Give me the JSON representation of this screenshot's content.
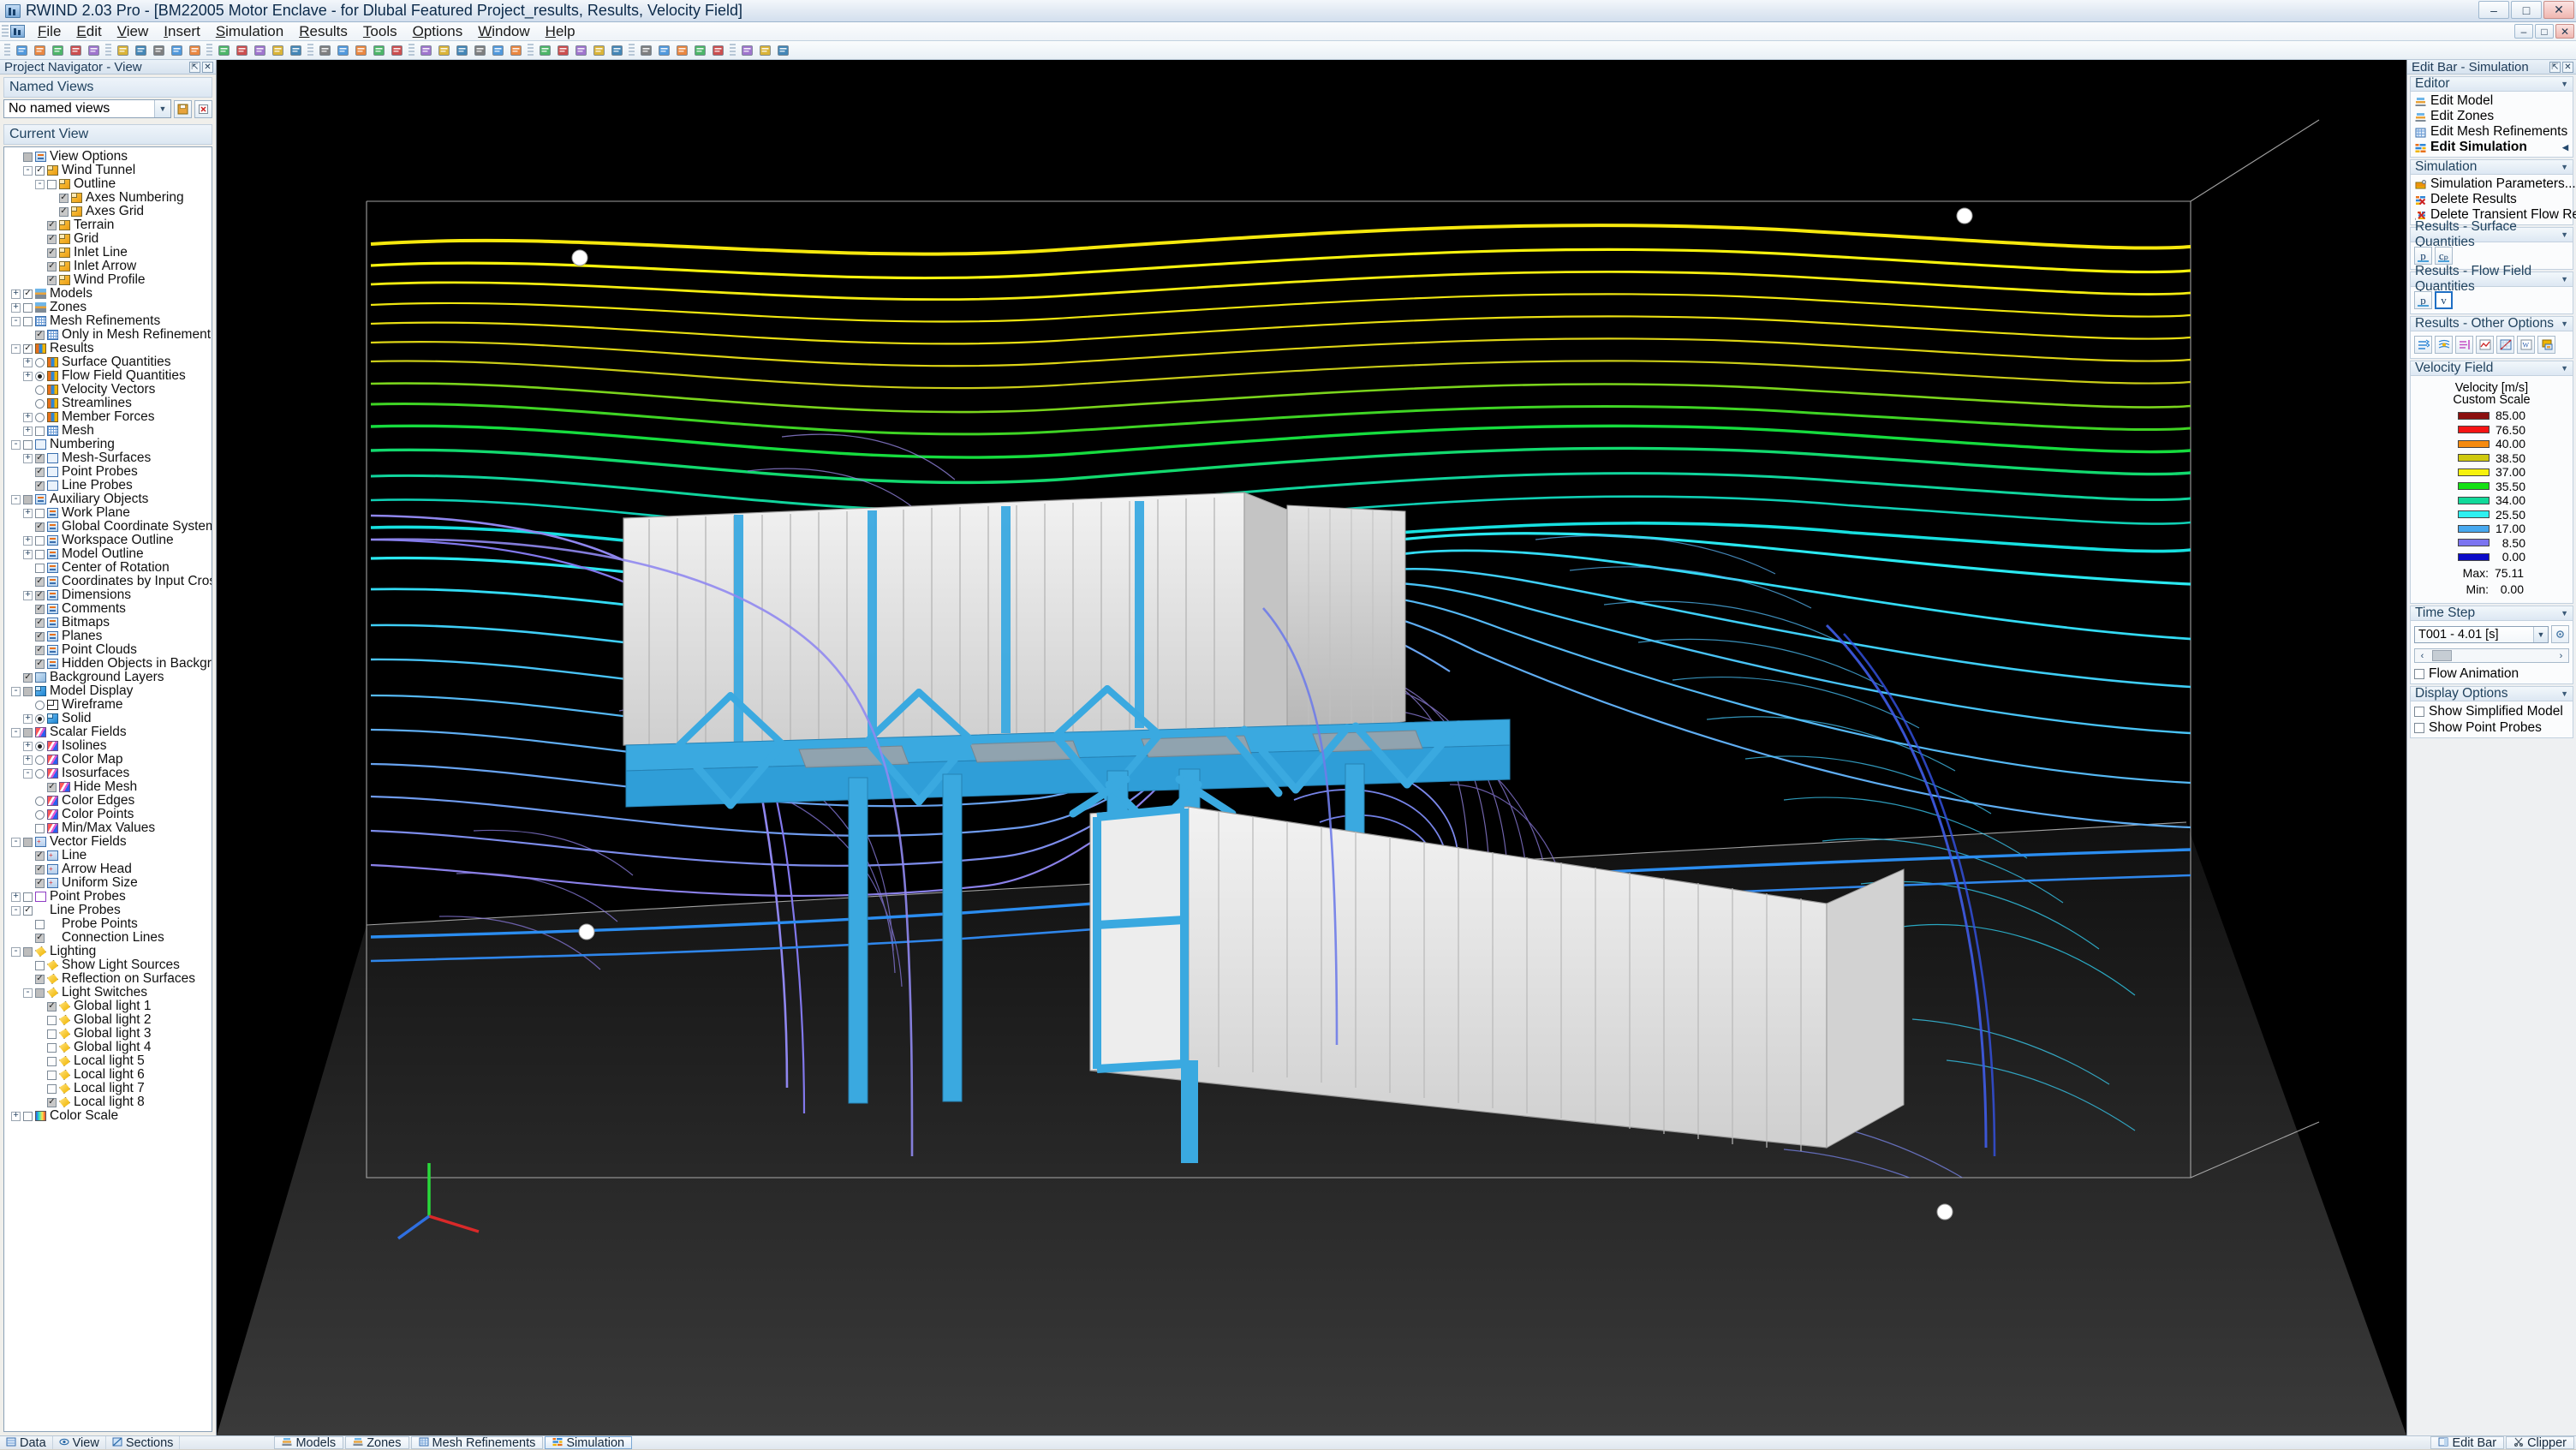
{
  "window": {
    "title": "RWIND 2.03 Pro - [BM22005 Motor Enclave - for Dlubal Featured Project_results, Results, Velocity Field]",
    "app_icon": "rwind-app-icon",
    "minimize": "–",
    "maximize": "□",
    "close": "✕"
  },
  "menu": [
    "File",
    "Edit",
    "View",
    "Insert",
    "Simulation",
    "Results",
    "Tools",
    "Options",
    "Window",
    "Help"
  ],
  "toolbar": {
    "icons": [
      "new-file-icon",
      "open-folder-icon",
      "save-icon",
      "save-as-icon",
      "print-icon",
      "undo-icon",
      "redo-icon",
      "cut-icon",
      "copy-icon",
      "paste-icon",
      "zoom-in-icon",
      "zoom-out-icon",
      "zoom-fit-icon",
      "pan-icon",
      "rotate-icon",
      "render-icon",
      "wireframe-icon",
      "solid-icon",
      "measure-icon",
      "section-icon",
      "grid-icon",
      "snap-icon",
      "view-front-icon",
      "view-top-icon",
      "view-iso-icon",
      "mesh-icon",
      "run-simulation-icon",
      "stop-icon",
      "results-icon",
      "animation-icon",
      "probe-icon",
      "streamline-icon",
      "isoline-icon",
      "colormap-icon",
      "vector-icon",
      "legend-icon",
      "screenshot-icon",
      "settings-icon",
      "help-icon"
    ]
  },
  "left_panel": {
    "header": "Project Navigator - View",
    "pin_icon": "pin-icon",
    "close_icon": "close-icon",
    "named_views_label": "Named Views",
    "named_views_value": "No named views",
    "current_view_label": "Current View",
    "tree": [
      {
        "lvl": 0,
        "exp": "",
        "chk": "square-gray",
        "icon": "ic-aux",
        "label": "View Options"
      },
      {
        "lvl": 1,
        "exp": "-",
        "chk": "checked",
        "icon": "ic-cube",
        "label": "Wind Tunnel"
      },
      {
        "lvl": 2,
        "exp": "-",
        "chk": "unchecked",
        "icon": "ic-cube",
        "label": "Outline"
      },
      {
        "lvl": 3,
        "exp": "",
        "chk": "checked-gray",
        "icon": "ic-cube",
        "label": "Axes Numbering"
      },
      {
        "lvl": 3,
        "exp": "",
        "chk": "checked-gray",
        "icon": "ic-cube",
        "label": "Axes Grid"
      },
      {
        "lvl": 2,
        "exp": "",
        "chk": "checked-gray",
        "icon": "ic-cube",
        "label": "Terrain"
      },
      {
        "lvl": 2,
        "exp": "",
        "chk": "checked-gray",
        "icon": "ic-cube",
        "label": "Grid"
      },
      {
        "lvl": 2,
        "exp": "",
        "chk": "checked-gray",
        "icon": "ic-cube",
        "label": "Inlet Line"
      },
      {
        "lvl": 2,
        "exp": "",
        "chk": "checked-gray",
        "icon": "ic-cube",
        "label": "Inlet Arrow"
      },
      {
        "lvl": 2,
        "exp": "",
        "chk": "checked-gray",
        "icon": "ic-cube",
        "label": "Wind Profile"
      },
      {
        "lvl": 0,
        "exp": "+",
        "chk": "checked",
        "icon": "ic-model",
        "label": "Models"
      },
      {
        "lvl": 0,
        "exp": "+",
        "chk": "unchecked",
        "icon": "ic-model",
        "label": "Zones"
      },
      {
        "lvl": 0,
        "exp": "-",
        "chk": "unchecked",
        "icon": "ic-mesh",
        "label": "Mesh Refinements"
      },
      {
        "lvl": 1,
        "exp": "",
        "chk": "checked-gray",
        "icon": "ic-mesh",
        "label": "Only in Mesh Refinement Editor"
      },
      {
        "lvl": 0,
        "exp": "-",
        "chk": "checked",
        "icon": "ic-res",
        "label": "Results"
      },
      {
        "lvl": 1,
        "exp": "+",
        "chk": "radio-off",
        "icon": "ic-res",
        "label": "Surface Quantities"
      },
      {
        "lvl": 1,
        "exp": "+",
        "chk": "radio-on",
        "icon": "ic-res",
        "label": "Flow Field Quantities"
      },
      {
        "lvl": 1,
        "exp": "",
        "chk": "radio-off",
        "icon": "ic-res",
        "label": "Velocity Vectors"
      },
      {
        "lvl": 1,
        "exp": "",
        "chk": "radio-off",
        "icon": "ic-res",
        "label": "Streamlines"
      },
      {
        "lvl": 1,
        "exp": "+",
        "chk": "radio-off",
        "icon": "ic-res",
        "label": "Member Forces"
      },
      {
        "lvl": 1,
        "exp": "+",
        "chk": "unchecked",
        "icon": "ic-mesh",
        "label": "Mesh"
      },
      {
        "lvl": 0,
        "exp": "-",
        "chk": "unchecked",
        "icon": "ic-num",
        "label": "Numbering"
      },
      {
        "lvl": 1,
        "exp": "+",
        "chk": "checked-gray",
        "icon": "ic-num",
        "label": "Mesh-Surfaces"
      },
      {
        "lvl": 1,
        "exp": "",
        "chk": "checked-gray",
        "icon": "ic-num",
        "label": "Point Probes"
      },
      {
        "lvl": 1,
        "exp": "",
        "chk": "checked-gray",
        "icon": "ic-num",
        "label": "Line Probes"
      },
      {
        "lvl": 0,
        "exp": "-",
        "chk": "square-gray",
        "icon": "ic-aux",
        "label": "Auxiliary Objects"
      },
      {
        "lvl": 1,
        "exp": "+",
        "chk": "unchecked",
        "icon": "ic-aux",
        "label": "Work Plane"
      },
      {
        "lvl": 1,
        "exp": "",
        "chk": "checked-gray",
        "icon": "ic-aux",
        "label": "Global Coordinate System (fixed)"
      },
      {
        "lvl": 1,
        "exp": "+",
        "chk": "unchecked",
        "icon": "ic-aux",
        "label": "Workspace Outline"
      },
      {
        "lvl": 1,
        "exp": "+",
        "chk": "unchecked",
        "icon": "ic-aux",
        "label": "Model Outline"
      },
      {
        "lvl": 1,
        "exp": "",
        "chk": "unchecked",
        "icon": "ic-aux",
        "label": "Center of Rotation"
      },
      {
        "lvl": 1,
        "exp": "",
        "chk": "checked-gray",
        "icon": "ic-aux",
        "label": "Coordinates by Input Cross"
      },
      {
        "lvl": 1,
        "exp": "+",
        "chk": "checked-gray",
        "icon": "ic-aux",
        "label": "Dimensions"
      },
      {
        "lvl": 1,
        "exp": "",
        "chk": "checked-gray",
        "icon": "ic-aux",
        "label": "Comments"
      },
      {
        "lvl": 1,
        "exp": "",
        "chk": "checked-gray",
        "icon": "ic-aux",
        "label": "Bitmaps"
      },
      {
        "lvl": 1,
        "exp": "",
        "chk": "checked-gray",
        "icon": "ic-aux",
        "label": "Planes"
      },
      {
        "lvl": 1,
        "exp": "",
        "chk": "checked-gray",
        "icon": "ic-aux",
        "label": "Point Clouds"
      },
      {
        "lvl": 1,
        "exp": "",
        "chk": "checked-gray",
        "icon": "ic-aux",
        "label": "Hidden Objects in Background"
      },
      {
        "lvl": 0,
        "exp": "",
        "chk": "checked-gray",
        "icon": "ic-layers",
        "label": "Background Layers"
      },
      {
        "lvl": 0,
        "exp": "-",
        "chk": "square-gray",
        "icon": "ic-cubeblue",
        "label": "Model Display"
      },
      {
        "lvl": 1,
        "exp": "",
        "chk": "radio-off",
        "icon": "ic-wire",
        "label": "Wireframe"
      },
      {
        "lvl": 1,
        "exp": "+",
        "chk": "radio-on",
        "icon": "ic-cubeblue",
        "label": "Solid"
      },
      {
        "lvl": 0,
        "exp": "-",
        "chk": "square-gray",
        "icon": "ic-scalar",
        "label": "Scalar Fields"
      },
      {
        "lvl": 1,
        "exp": "+",
        "chk": "radio-on",
        "icon": "ic-scalar",
        "label": "Isolines"
      },
      {
        "lvl": 1,
        "exp": "+",
        "chk": "radio-off",
        "icon": "ic-scalar",
        "label": "Color Map"
      },
      {
        "lvl": 1,
        "exp": "-",
        "chk": "radio-off",
        "icon": "ic-scalar",
        "label": "Isosurfaces"
      },
      {
        "lvl": 2,
        "exp": "",
        "chk": "checked-gray",
        "icon": "ic-scalar",
        "label": "Hide Mesh"
      },
      {
        "lvl": 1,
        "exp": "",
        "chk": "radio-off",
        "icon": "ic-scalar",
        "label": "Color Edges"
      },
      {
        "lvl": 1,
        "exp": "",
        "chk": "radio-off",
        "icon": "ic-scalar",
        "label": "Color Points"
      },
      {
        "lvl": 1,
        "exp": "",
        "chk": "unchecked",
        "icon": "ic-scalar",
        "label": "Min/Max Values"
      },
      {
        "lvl": 0,
        "exp": "-",
        "chk": "square-gray",
        "icon": "ic-vector",
        "label": "Vector Fields"
      },
      {
        "lvl": 1,
        "exp": "",
        "chk": "checked-gray",
        "icon": "ic-vector",
        "label": "Line"
      },
      {
        "lvl": 1,
        "exp": "",
        "chk": "checked-gray",
        "icon": "ic-vector",
        "label": "Arrow Head"
      },
      {
        "lvl": 1,
        "exp": "",
        "chk": "checked-gray",
        "icon": "ic-vector",
        "label": "Uniform Size"
      },
      {
        "lvl": 0,
        "exp": "+",
        "chk": "unchecked",
        "icon": "ic-pp",
        "label": "Point Probes"
      },
      {
        "lvl": 0,
        "exp": "-",
        "chk": "checked",
        "icon": "ic-lp",
        "label": "Line Probes"
      },
      {
        "lvl": 1,
        "exp": "",
        "chk": "unchecked",
        "icon": "ic-lp",
        "label": "Probe Points"
      },
      {
        "lvl": 1,
        "exp": "",
        "chk": "checked-gray",
        "icon": "ic-lp",
        "label": "Connection Lines"
      },
      {
        "lvl": 0,
        "exp": "-",
        "chk": "square-gray",
        "icon": "ic-light",
        "label": "Lighting"
      },
      {
        "lvl": 1,
        "exp": "",
        "chk": "unchecked",
        "icon": "ic-light",
        "label": "Show Light Sources"
      },
      {
        "lvl": 1,
        "exp": "",
        "chk": "checked-gray",
        "icon": "ic-light",
        "label": "Reflection on Surfaces"
      },
      {
        "lvl": 1,
        "exp": "-",
        "chk": "square-gray",
        "icon": "ic-light",
        "label": "Light Switches"
      },
      {
        "lvl": 2,
        "exp": "",
        "chk": "checked-gray",
        "icon": "ic-light",
        "label": "Global light 1"
      },
      {
        "lvl": 2,
        "exp": "",
        "chk": "unchecked",
        "icon": "ic-light",
        "label": "Global light 2"
      },
      {
        "lvl": 2,
        "exp": "",
        "chk": "unchecked",
        "icon": "ic-light",
        "label": "Global light 3"
      },
      {
        "lvl": 2,
        "exp": "",
        "chk": "unchecked",
        "icon": "ic-light",
        "label": "Global light 4"
      },
      {
        "lvl": 2,
        "exp": "",
        "chk": "unchecked",
        "icon": "ic-light",
        "label": "Local light 5"
      },
      {
        "lvl": 2,
        "exp": "",
        "chk": "unchecked",
        "icon": "ic-light",
        "label": "Local light 6"
      },
      {
        "lvl": 2,
        "exp": "",
        "chk": "unchecked",
        "icon": "ic-light",
        "label": "Local light 7"
      },
      {
        "lvl": 2,
        "exp": "",
        "chk": "checked-gray",
        "icon": "ic-light",
        "label": "Local light 8"
      },
      {
        "lvl": 0,
        "exp": "+",
        "chk": "unchecked",
        "icon": "ic-cs",
        "label": "Color Scale"
      }
    ]
  },
  "right_panel": {
    "header": "Edit Bar - Simulation",
    "pin_icon": "pin-icon",
    "close_icon": "close-icon",
    "sections": {
      "editor": {
        "title": "Editor",
        "items": [
          {
            "label": "Edit Model",
            "icon": "edit-model-icon",
            "active": false
          },
          {
            "label": "Edit Zones",
            "icon": "edit-zones-icon",
            "active": false
          },
          {
            "label": "Edit Mesh Refinements",
            "icon": "edit-mesh-icon",
            "active": false
          },
          {
            "label": "Edit Simulation",
            "icon": "edit-simulation-icon",
            "active": true
          }
        ]
      },
      "simulation": {
        "title": "Simulation",
        "items": [
          {
            "label": "Simulation Parameters...",
            "icon": "simulation-parameters-icon"
          },
          {
            "label": "Delete Results",
            "icon": "delete-results-icon"
          },
          {
            "label": "Delete Transient Flow Results...",
            "icon": "delete-transient-results-icon"
          }
        ]
      },
      "surface_quantities": {
        "title": "Results - Surface Quantities",
        "buttons": [
          {
            "label": "p",
            "name": "pressure-surface-button",
            "selected": false
          },
          {
            "label": "cₚ",
            "name": "cp-surface-button",
            "selected": false
          }
        ]
      },
      "flow_field_quantities": {
        "title": "Results - Flow Field Quantities",
        "buttons": [
          {
            "label": "p",
            "name": "pressure-flow-button",
            "selected": false
          },
          {
            "label": "v",
            "name": "velocity-flow-button",
            "selected": true
          }
        ]
      },
      "other_options": {
        "title": "Results - Other Options",
        "buttons": [
          "velocity-vectors-icon",
          "streamlines-icon",
          "isolines-icon",
          "result-diagram-icon",
          "chart-icon",
          "word-report-icon",
          "printout-report-icon"
        ]
      },
      "velocity_field": {
        "title": "Velocity Field",
        "legend_title": "Velocity [m/s]",
        "legend_subtitle": "Custom Scale",
        "max_label": "Max:",
        "max_value": "75.11",
        "min_label": "Min:",
        "min_value": "0.00"
      },
      "time_step": {
        "title": "Time Step",
        "value": "T001 - 4.01 [s]",
        "settings_icon": "gear-icon",
        "prev_icon": "‹",
        "next_icon": "›",
        "flow_animation_label": "Flow Animation",
        "flow_animation_checked": false
      },
      "display_options": {
        "title": "Display Options",
        "items": [
          {
            "label": "Show Simplified Model",
            "checked": false
          },
          {
            "label": "Show Point Probes",
            "checked": false
          }
        ]
      }
    }
  },
  "chart_data": {
    "type": "heatmap",
    "title": "Velocity [m/s]",
    "subtitle": "Custom Scale",
    "unit": "m/s",
    "scale_type": "Custom Scale",
    "max": 75.11,
    "min": 0.0,
    "legend_position": "right-sidebar",
    "stops": [
      {
        "value": "85.00",
        "color": "#8b0f0f"
      },
      {
        "value": "76.50",
        "color": "#f51414"
      },
      {
        "value": "40.00",
        "color": "#f58a0f"
      },
      {
        "value": "38.50",
        "color": "#cfc90e"
      },
      {
        "value": "37.00",
        "color": "#f6f20d"
      },
      {
        "value": "35.50",
        "color": "#14e014"
      },
      {
        "value": "34.00",
        "color": "#10d99a"
      },
      {
        "value": "25.50",
        "color": "#2ef0f0"
      },
      {
        "value": "17.00",
        "color": "#46a8ef"
      },
      {
        "value": "8.50",
        "color": "#7b73f0"
      },
      {
        "value": "0.00",
        "color": "#0a0ac8"
      }
    ]
  },
  "viewport": {
    "name": "3d-cfd-viewport",
    "axis_x": "X",
    "axis_y": "Y",
    "axis_z": "Z"
  },
  "statusbar": {
    "left_items": [
      {
        "label": "Data",
        "icon": "data-icon"
      },
      {
        "label": "View",
        "icon": "view-icon"
      },
      {
        "label": "Sections",
        "icon": "sections-icon"
      }
    ],
    "tabs": [
      {
        "label": "Models",
        "icon": "models-icon",
        "active": false
      },
      {
        "label": "Zones",
        "icon": "zones-icon",
        "active": false
      },
      {
        "label": "Mesh Refinements",
        "icon": "mesh-refinements-icon",
        "active": false
      },
      {
        "label": "Simulation",
        "icon": "simulation-icon",
        "active": true
      }
    ],
    "right_items": [
      {
        "label": "Edit Bar",
        "icon": "edit-bar-icon"
      },
      {
        "label": "Clipper",
        "icon": "clipper-icon"
      }
    ]
  }
}
